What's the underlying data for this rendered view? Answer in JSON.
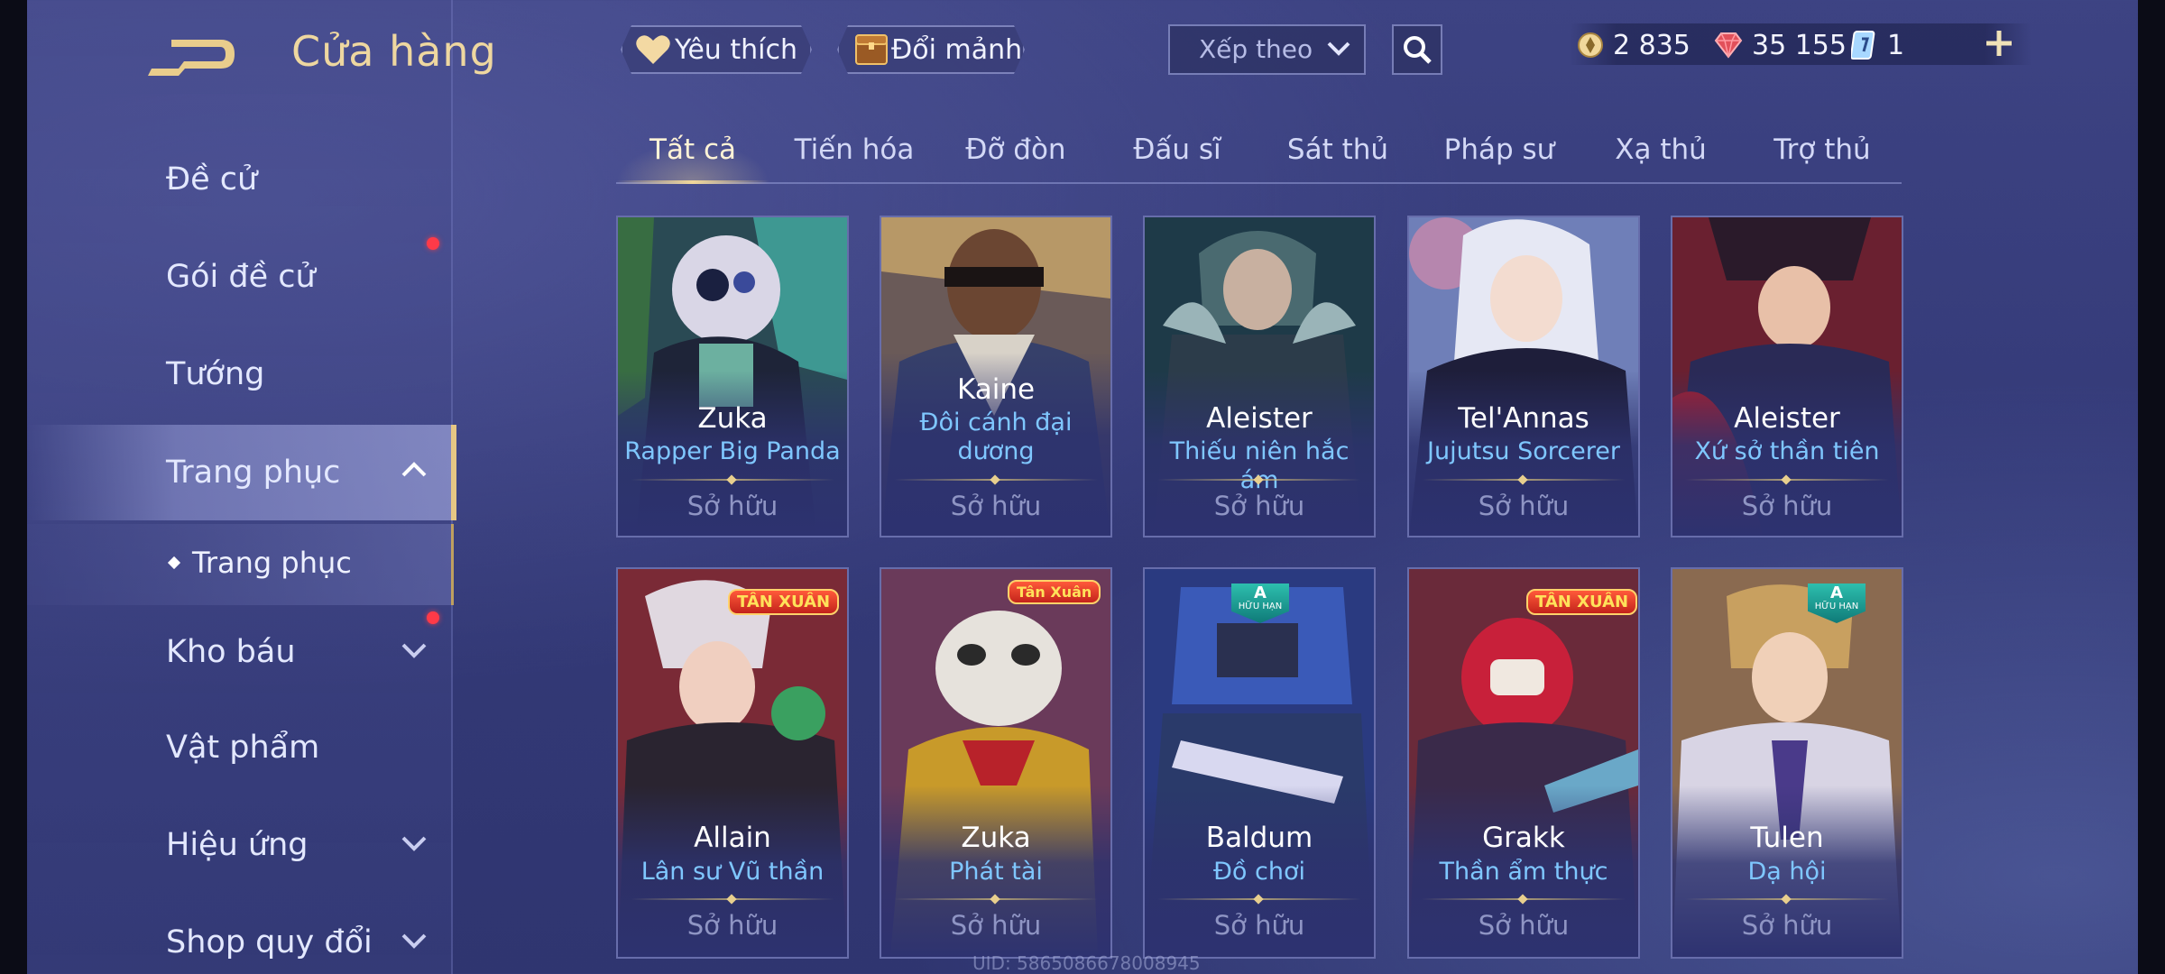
{
  "header": {
    "title": "Cửa hàng",
    "favorite_label": "Yêu thích",
    "exchange_label": "Đổi mảnh",
    "sort_label": "Xếp theo"
  },
  "currencies": {
    "gold": "2 835",
    "gems": "35 155",
    "vouchers": "1"
  },
  "sidebar": {
    "items": [
      {
        "label": "Đề cử"
      },
      {
        "label": "Gói đề cử"
      },
      {
        "label": "Tướng"
      },
      {
        "label": "Trang phục"
      },
      {
        "label": "Kho báu"
      },
      {
        "label": "Vật phẩm"
      },
      {
        "label": "Hiệu ứng"
      },
      {
        "label": "Shop quy đổi"
      }
    ],
    "sub_item": "Trang phục"
  },
  "tabs": [
    "Tất cả",
    "Tiến hóa",
    "Đỡ đòn",
    "Đấu sĩ",
    "Sát thủ",
    "Pháp sư",
    "Xạ thủ",
    "Trợ thủ"
  ],
  "cards": [
    {
      "hero": "Zuka",
      "skin": "Rapper Big Panda",
      "status": "Sở hữu"
    },
    {
      "hero": "Kaine",
      "skin": "Đôi cánh đại dương",
      "status": "Sở hữu"
    },
    {
      "hero": "Aleister",
      "skin": "Thiếu niên hắc ám",
      "status": "Sở hữu"
    },
    {
      "hero": "Tel'Annas",
      "skin": "Jujutsu Sorcerer",
      "status": "Sở hữu"
    },
    {
      "hero": "Aleister",
      "skin": "Xứ sở thần tiên",
      "status": "Sở hữu"
    },
    {
      "hero": "Allain",
      "skin": "Lân sư Vũ thần",
      "status": "Sở hữu",
      "badge": "TÂN XUÂN"
    },
    {
      "hero": "Zuka",
      "skin": "Phát tài",
      "status": "Sở hữu",
      "badge": "Tân Xuân"
    },
    {
      "hero": "Baldum",
      "skin": "Đồ chơi",
      "status": "Sở hữu",
      "limited": {
        "grade": "A",
        "label": "HỮU HẠN"
      }
    },
    {
      "hero": "Grakk",
      "skin": "Thần ẩm thực",
      "status": "Sở hữu",
      "badge": "TÂN XUÂN"
    },
    {
      "hero": "Tulen",
      "skin": "Dạ hội",
      "status": "Sở hữu",
      "limited": {
        "grade": "A",
        "label": "HỮU HẠN"
      }
    }
  ],
  "footer": {
    "uid": "UID: 5865086678008945"
  },
  "colors": {
    "background": "#363c7b",
    "accent_gold": "#eed7a0",
    "skin_name": "#7fc7ff",
    "notification": "#ff3a48"
  }
}
